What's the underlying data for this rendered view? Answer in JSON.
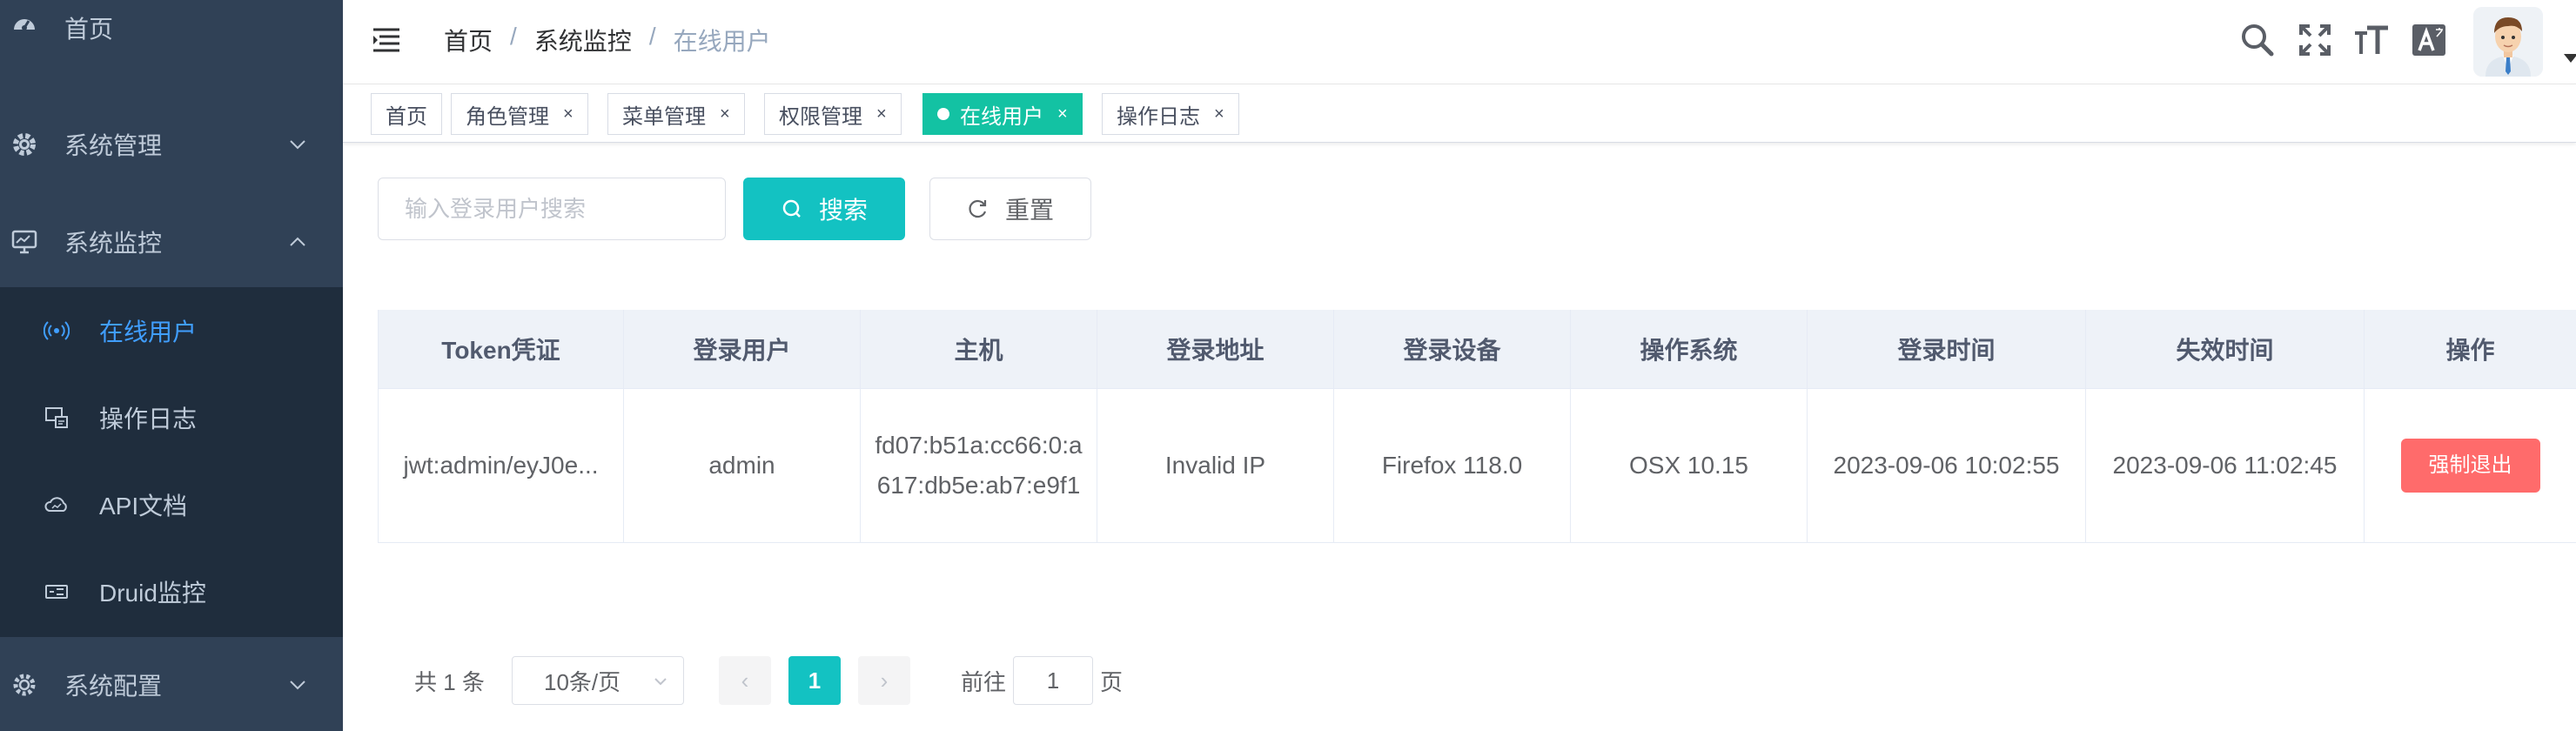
{
  "sidebar": {
    "items": [
      {
        "label": "首页",
        "icon": "dashboard-icon"
      },
      {
        "label": "系统管理",
        "icon": "gear-icon"
      },
      {
        "label": "系统监控",
        "icon": "monitor-icon"
      },
      {
        "label": "系统配置",
        "icon": "settings-cog-icon"
      }
    ],
    "submenu": [
      {
        "label": "在线用户",
        "icon": "online-signal-icon",
        "active": true
      },
      {
        "label": "操作日志",
        "icon": "log-icon"
      },
      {
        "label": "API文档",
        "icon": "cloud-icon"
      },
      {
        "label": "Druid监控",
        "icon": "druid-icon"
      }
    ],
    "bg_color": "#304156",
    "active_color": "#409eff"
  },
  "navbar": {
    "breadcrumb": [
      "首页",
      "系统监控",
      "在线用户"
    ],
    "separator": "/",
    "icons": [
      "search-icon",
      "fullscreen-icon",
      "font-size-icon",
      "translate-icon"
    ]
  },
  "tags": [
    {
      "label": "首页",
      "closable": false,
      "active": false
    },
    {
      "label": "角色管理",
      "closable": true,
      "active": false
    },
    {
      "label": "菜单管理",
      "closable": true,
      "active": false
    },
    {
      "label": "权限管理",
      "closable": true,
      "active": false
    },
    {
      "label": "在线用户",
      "closable": true,
      "active": true
    },
    {
      "label": "操作日志",
      "closable": true,
      "active": false
    }
  ],
  "tag_close": "×",
  "search": {
    "placeholder": "输入登录用户搜索",
    "value": "",
    "search_label": "搜索",
    "reset_label": "重置"
  },
  "table": {
    "columns": [
      "Token凭证",
      "登录用户",
      "主机",
      "登录地址",
      "登录设备",
      "操作系统",
      "登录时间",
      "失效时间",
      "操作"
    ],
    "rows": [
      {
        "token": "jwt:admin/eyJ0e...",
        "user": "admin",
        "host": "fd07:b51a:cc66:0:a617:db5e:ab7:e9f1",
        "address": "Invalid IP",
        "device": "Firefox 118.0",
        "os": "OSX 10.15",
        "login_time": "2023-09-06 10:02:55",
        "expire_time": "2023-09-06 11:02:45",
        "action": "强制退出"
      }
    ]
  },
  "pagination": {
    "total": "共 1 条",
    "page_size": "10条/页",
    "prev": "‹",
    "next": "›",
    "current": "1",
    "goto_label": "前往",
    "goto_value": "1",
    "page_suffix": "页"
  },
  "colors": {
    "accent": "#13c2c2",
    "danger": "#ff6b6b"
  }
}
